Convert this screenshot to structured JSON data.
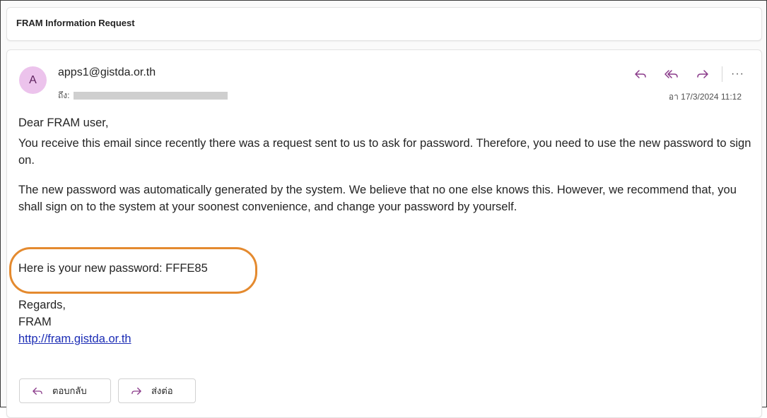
{
  "subject": "FRAM Information Request",
  "message": {
    "avatar_initial": "A",
    "sender": "apps1@gistda.or.th",
    "to_label": "ถึง:",
    "date": "อา 17/3/2024 11:12",
    "more_label": "···",
    "greeting": "Dear FRAM user,",
    "paragraph1": "You receive this email since recently there was a request sent to us to ask for password. Therefore, you need to use the new password to sign on.",
    "paragraph2": "The new password was automatically generated by the system. We believe that no one else knows this. However, we recommend that, you shall sign on to the system at your soonest convenience, and change your password by yourself.",
    "password_line": "Here is your new password: FFFE85",
    "regards": "Regards,",
    "signature": "FRAM",
    "link": "http://fram.gistda.or.th"
  },
  "buttons": {
    "reply": "ตอบกลับ",
    "forward": "ส่งต่อ"
  },
  "icons": {
    "reply": "reply-icon",
    "reply_all": "reply-all-icon",
    "forward": "forward-icon",
    "more": "more-icon"
  },
  "colors": {
    "accent": "#8a3a8a",
    "avatar_bg": "#ecc3ec",
    "highlight_ring": "#e48a2f",
    "link": "#1c2db5"
  }
}
